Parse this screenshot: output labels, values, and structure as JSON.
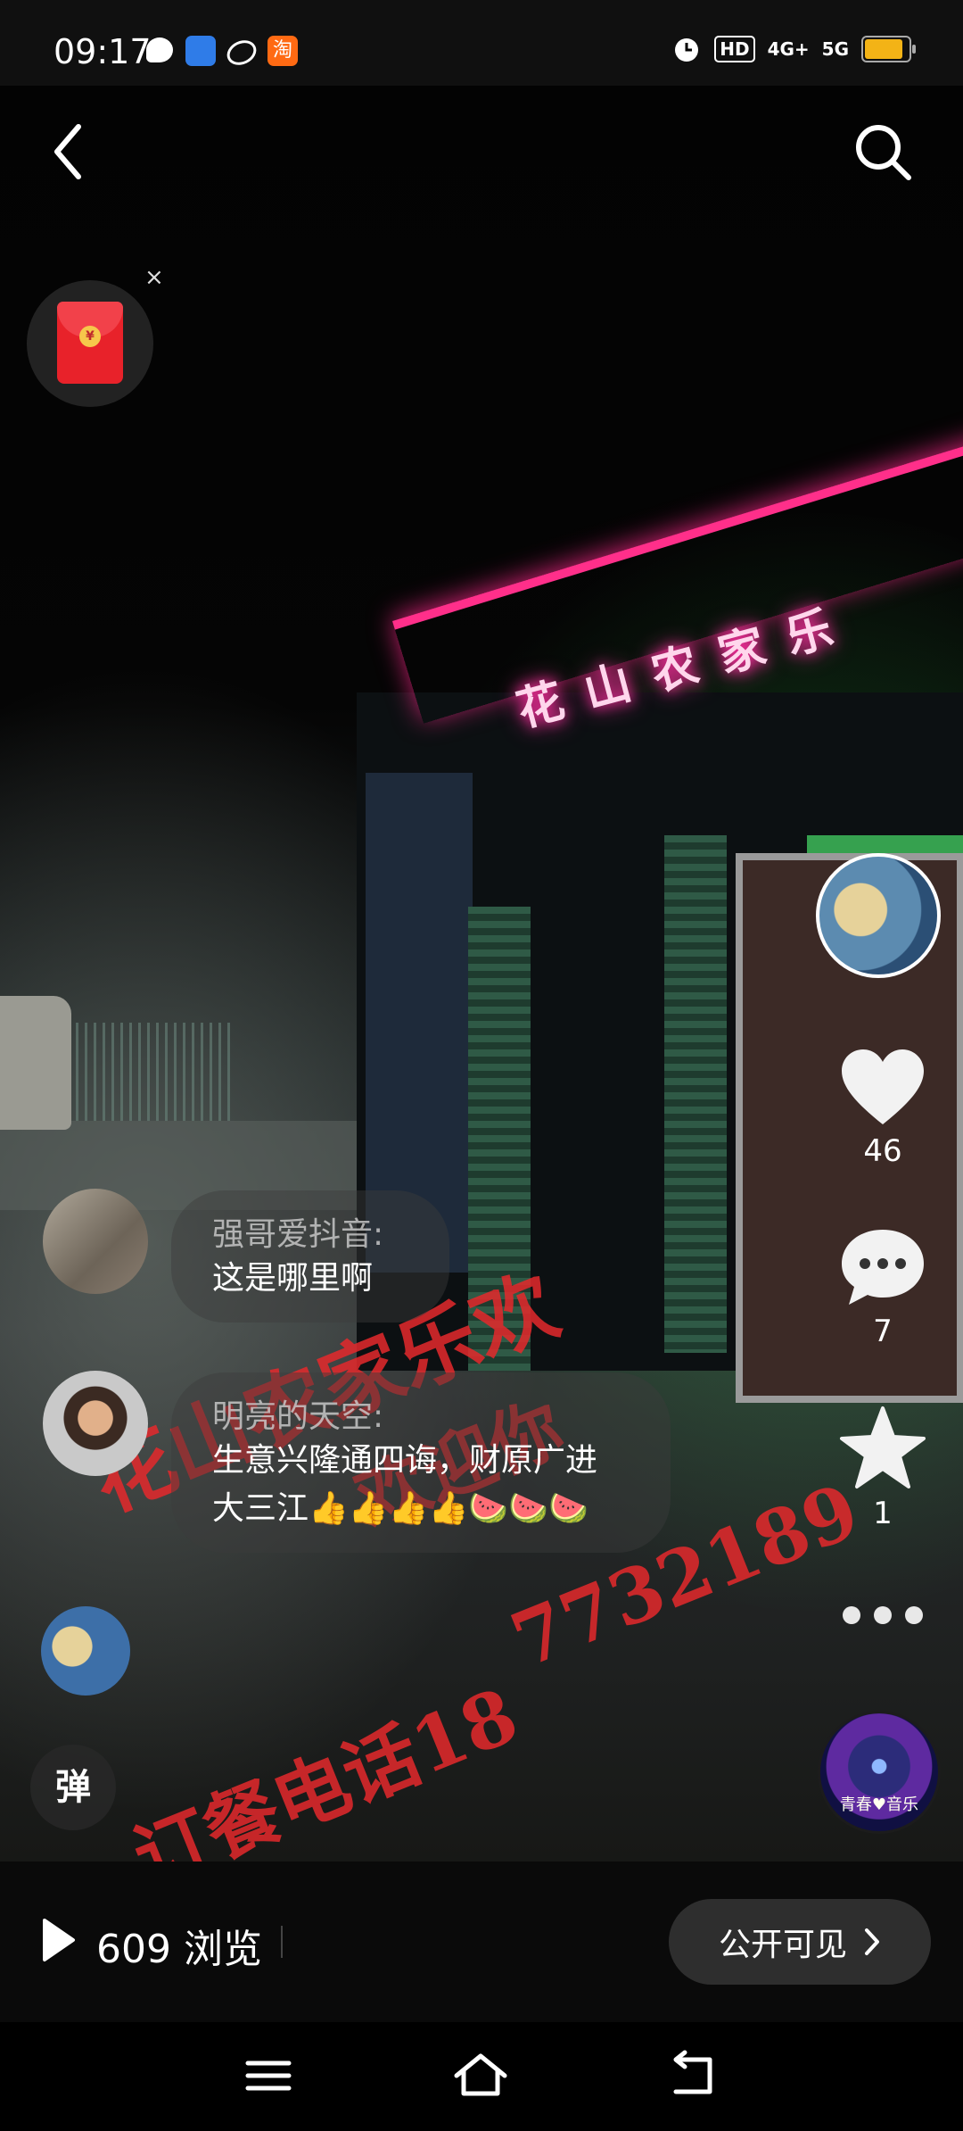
{
  "status_bar": {
    "time": "09:17",
    "notification_icons": [
      "message-icon",
      "baidu-icon",
      "swirl-icon",
      "taobao-icon"
    ],
    "taobao_glyph": "淘",
    "network": [
      "HD",
      "4G+",
      "5G"
    ],
    "battery_color": "#f3b316"
  },
  "header": {
    "back_icon": "chevron-left-icon",
    "search_icon": "search-icon"
  },
  "promo": {
    "icon": "red-envelope-icon",
    "coin_glyph": "¥",
    "close_glyph": "×"
  },
  "video": {
    "neon_sign": "花山农家乐",
    "watermark_lines": [
      "花山农家乐欢",
      "农家乐欢",
      "欢迎你",
      "订餐电话18",
      "7732189"
    ]
  },
  "sidebar": {
    "like_count": "46",
    "comment_count": "7",
    "favorite_count": "1",
    "music_label": "青春♥音乐"
  },
  "comments": [
    {
      "name": "强哥爱抖音:",
      "text": "这是哪里啊"
    },
    {
      "name": "明亮的天空:",
      "text_line1": "生意兴隆通四诲，财原广进",
      "text_line2": "大三江👍👍👍👍🍉🍉🍉"
    }
  ],
  "danmu_toggle": "弹",
  "bottom": {
    "view_count": "609",
    "view_label": "浏览",
    "visibility_label": "公开可见"
  },
  "colors": {
    "watermark": "#e5292c",
    "neon": "#ff2f8a"
  }
}
